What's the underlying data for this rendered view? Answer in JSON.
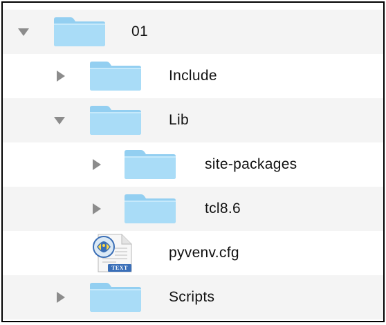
{
  "tree": {
    "rows": [
      {
        "label": "01",
        "kind": "folder",
        "expanded": true
      },
      {
        "label": "Include",
        "kind": "folder",
        "expanded": false
      },
      {
        "label": "Lib",
        "kind": "folder",
        "expanded": true
      },
      {
        "label": "site-packages",
        "kind": "folder",
        "expanded": false
      },
      {
        "label": "tcl8.6",
        "kind": "folder",
        "expanded": false
      },
      {
        "label": "pyvenv.cfg",
        "kind": "file",
        "file_badge": "TEXT"
      },
      {
        "label": "Scripts",
        "kind": "folder",
        "expanded": false
      }
    ]
  },
  "colors": {
    "folder_body": "#a9dcf7",
    "folder_tab": "#93cff1",
    "disclosure": "#8c8c8c",
    "alt_row": "#f4f4f4"
  },
  "icons": {
    "folder": "folder-icon",
    "file": "python-text-file-icon",
    "collapsed": "disclosure-triangle-right-icon",
    "expanded": "disclosure-triangle-down-icon"
  }
}
